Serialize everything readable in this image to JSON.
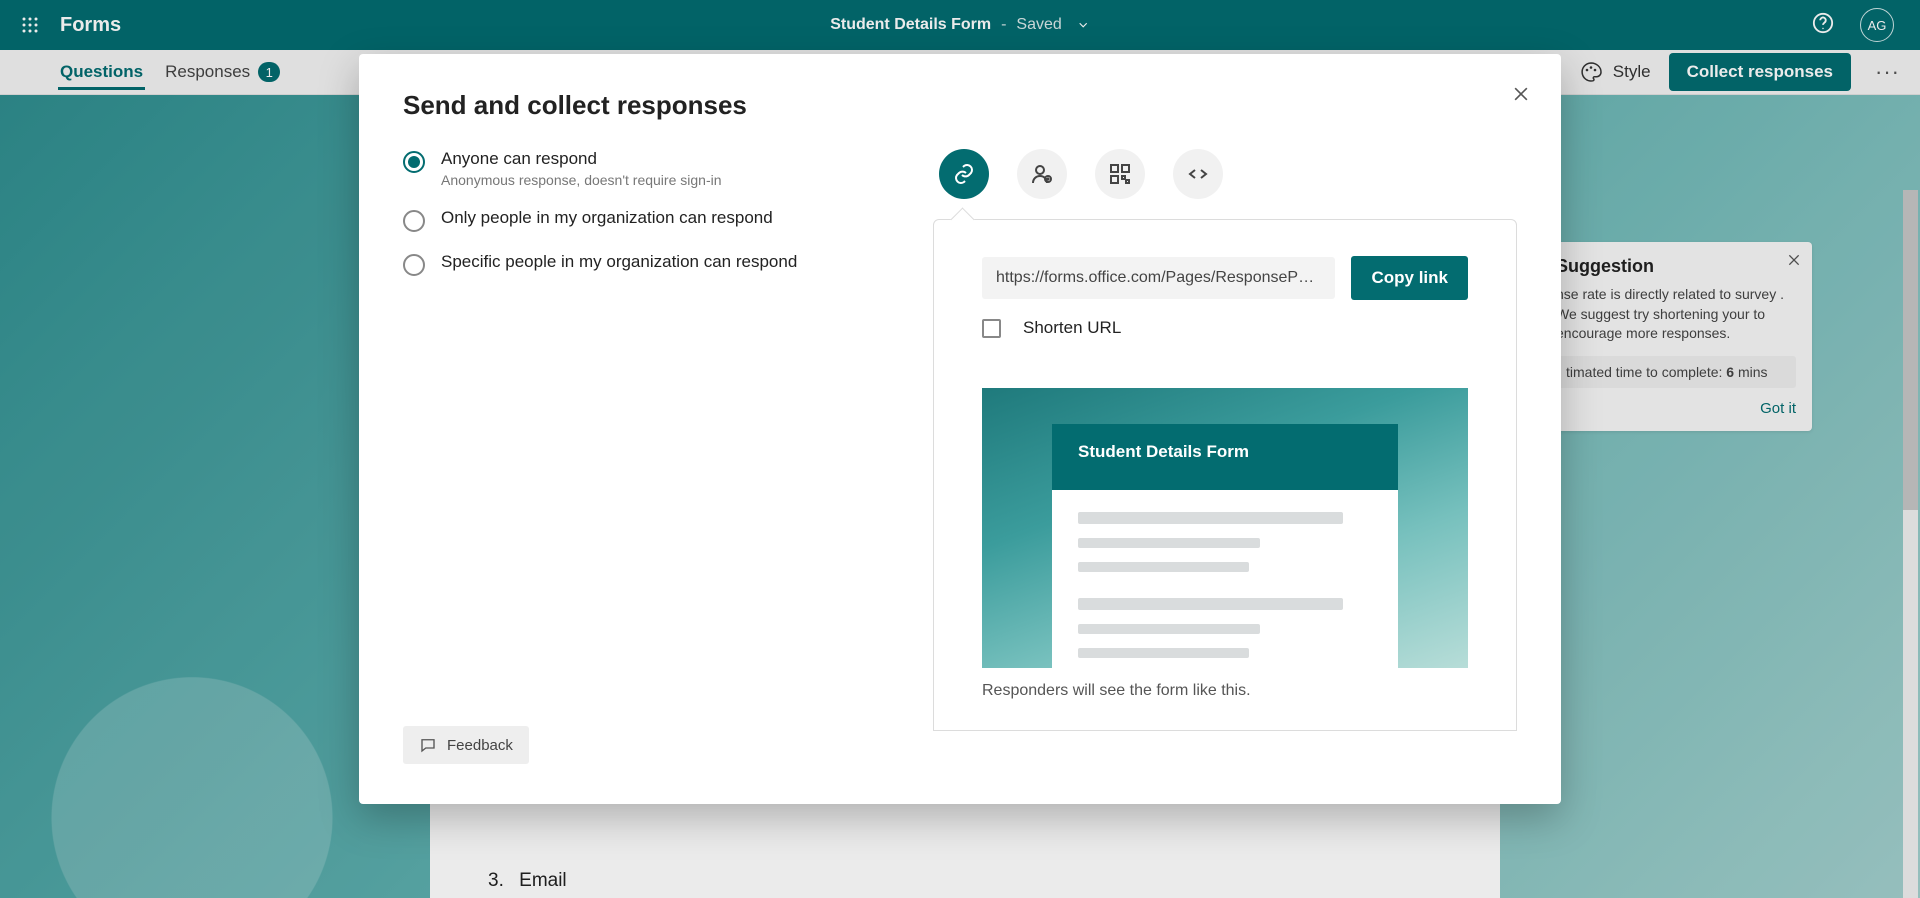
{
  "topbar": {
    "app_name": "Forms",
    "doc_title": "Student Details Form",
    "dash": "-",
    "saved": "Saved",
    "avatar_initials": "AG"
  },
  "subbar": {
    "tab_questions": "Questions",
    "tab_responses": "Responses",
    "responses_count": "1",
    "style": "Style",
    "collect": "Collect responses",
    "more": "···"
  },
  "suggestion": {
    "title": "Suggestion",
    "body": "nse rate is directly related to survey . We suggest try shortening your to encourage more responses.",
    "est_prefix": "timated time to complete: ",
    "est_value": "6",
    "est_suffix": " mins",
    "gotit": "Got it"
  },
  "question3": {
    "num": "3.",
    "label": "Email"
  },
  "modal": {
    "title": "Send and collect responses",
    "radio1_label": "Anyone can respond",
    "radio1_sub": "Anonymous response, doesn't require sign-in",
    "radio2_label": "Only people in my organization can respond",
    "radio3_label": "Specific people in my organization can respond",
    "feedback": "Feedback",
    "link_value": "https://forms.office.com/Pages/ResponsePag…",
    "copy": "Copy link",
    "shorten": "Shorten URL",
    "preview_form_title": "Student Details Form",
    "preview_caption": "Responders will see the form like this."
  }
}
